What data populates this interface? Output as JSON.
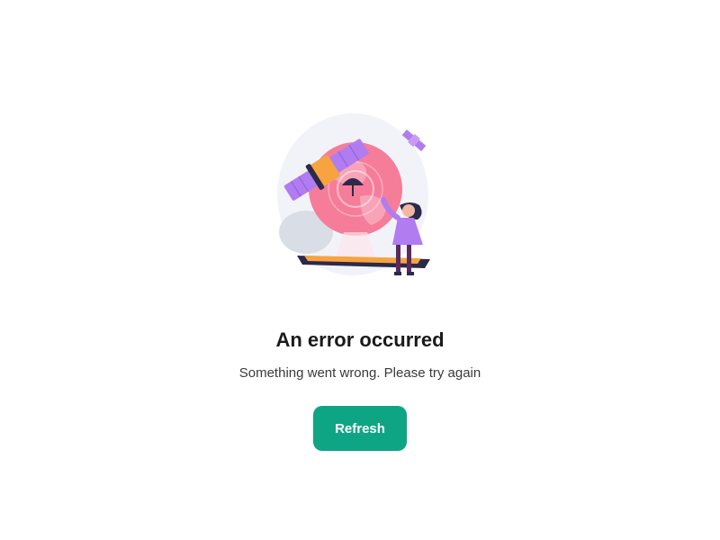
{
  "error": {
    "title": "An error occurred",
    "message": "Something went wrong. Please try again",
    "refresh_label": "Refresh"
  },
  "illustration": {
    "icon": "satellite-globe-illustration"
  },
  "colors": {
    "button_background": "#0ea585",
    "button_text": "#ffffff",
    "title_text": "#1a1a1a",
    "message_text": "#3a3a3a",
    "globe": "#f46b8d",
    "satellite_panel": "#b07cf0",
    "satellite_body": "#f6a340"
  }
}
